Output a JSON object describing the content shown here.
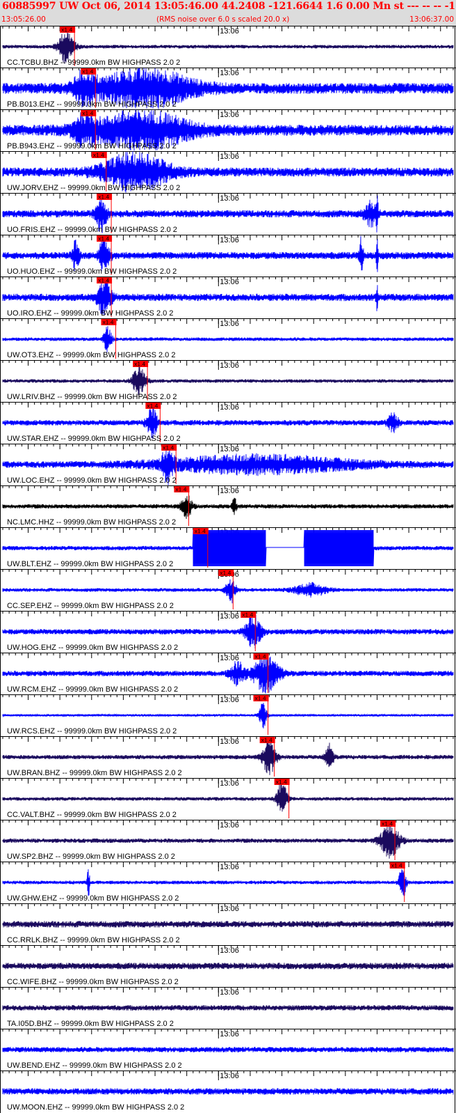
{
  "header": {
    "title": "60885997 UW Oct 06, 2014 13:05:46.00   44.2408 -121.6644  1.6 0.00 Mn st --- -- --  -1",
    "time_start": "13:05:26.00",
    "rms_note": "(RMS noise over 6.0 s scaled 20.0 x)",
    "time_end": "13:06:37.00"
  },
  "minute_label": "13:06",
  "pick_label": "x1.4",
  "colors": {
    "header_bg": "#dcdcdc",
    "header_text": "#ff0000",
    "trace_blue": "#0000ff",
    "trace_navy": "#1a0a5e",
    "trace_black": "#000000",
    "pick": "#ff0000"
  },
  "channels": [
    {
      "label": "CC.TCBU.BHZ -- 99999.0km BW  HIGHPASS  2.0  2",
      "color": "navy",
      "pick_sec": 9.0,
      "noise": 0.1,
      "events": [
        {
          "t": 10.0,
          "w": 1.2,
          "a": 0.9
        }
      ]
    },
    {
      "label": "PB.B013.EHZ -- 99999.0km BW  HIGHPASS  2.0  2",
      "color": "blue",
      "pick_sec": 12.3,
      "noise": 0.3,
      "events": [
        {
          "t": 13.0,
          "w": 1.5,
          "a": 1.0
        },
        {
          "t": 22.5,
          "w": 7.0,
          "a": 1.0
        }
      ]
    },
    {
      "label": "PB.B943.EHZ -- 99999.0km BW  HIGHPASS  2.0  2",
      "color": "blue",
      "pick_sec": 12.3,
      "noise": 0.3,
      "events": [
        {
          "t": 13.0,
          "w": 1.5,
          "a": 1.0
        },
        {
          "t": 22.0,
          "w": 7.0,
          "a": 1.0
        }
      ]
    },
    {
      "label": "UW.JORV.EHZ -- 99999.0km BW  HIGHPASS  2.0  2",
      "color": "blue",
      "pick_sec": 14.0,
      "noise": 0.25,
      "events": [
        {
          "t": 21.0,
          "w": 5.0,
          "a": 1.0
        }
      ]
    },
    {
      "label": "UO.FRIS.EHZ -- 99999.0km BW  HIGHPASS  2.0  2",
      "color": "blue",
      "pick_sec": 14.8,
      "noise": 0.2,
      "events": [
        {
          "t": 15.5,
          "w": 0.8,
          "a": 1.0
        },
        {
          "t": 58.0,
          "w": 1.0,
          "a": 0.6
        },
        {
          "t": 59.0,
          "w": 0.15,
          "a": 1.0
        }
      ]
    },
    {
      "label": "UO.HUO.EHZ -- 99999.0km BW  HIGHPASS  2.0  2",
      "color": "blue",
      "pick_sec": 14.8,
      "noise": 0.2,
      "events": [
        {
          "t": 11.5,
          "w": 0.5,
          "a": 0.8
        },
        {
          "t": 16.0,
          "w": 0.8,
          "a": 1.0
        },
        {
          "t": 56.5,
          "w": 0.3,
          "a": 1.0
        },
        {
          "t": 59.0,
          "w": 0.15,
          "a": 1.0
        }
      ]
    },
    {
      "label": "UO.IRO.EHZ -- 99999.0km BW  HIGHPASS  2.0  2",
      "color": "blue",
      "pick_sec": 14.8,
      "noise": 0.2,
      "events": [
        {
          "t": 16.0,
          "w": 1.0,
          "a": 1.0
        },
        {
          "t": 59.0,
          "w": 0.15,
          "a": 1.0
        }
      ]
    },
    {
      "label": "UW.OT3.EHZ -- 99999.0km BW  HIGHPASS  2.0  2",
      "color": "blue",
      "pick_sec": 15.5,
      "noise": 0.1,
      "events": [
        {
          "t": 16.5,
          "w": 0.6,
          "a": 0.7
        }
      ]
    },
    {
      "label": "UW.LRIV.BHZ -- 99999.0km BW  HIGHPASS  2.0  2",
      "color": "navy",
      "pick_sec": 20.5,
      "noise": 0.1,
      "events": [
        {
          "t": 21.5,
          "w": 1.0,
          "a": 0.8
        }
      ]
    },
    {
      "label": "UW.STAR.EHZ -- 99999.0km BW  HIGHPASS  2.0  2",
      "color": "blue",
      "pick_sec": 22.5,
      "noise": 0.15,
      "events": [
        {
          "t": 23.5,
          "w": 0.8,
          "a": 0.9
        },
        {
          "t": 61.5,
          "w": 0.8,
          "a": 0.5
        }
      ]
    },
    {
      "label": "UW.LOC.EHZ -- 99999.0km BW  HIGHPASS  2.0  2",
      "color": "blue",
      "pick_sec": 25.0,
      "noise": 0.18,
      "events": [
        {
          "t": 26.0,
          "w": 0.8,
          "a": 0.9
        },
        {
          "t": 40.0,
          "w": 15.0,
          "a": 0.45
        }
      ]
    },
    {
      "label": "NC.LMC.HHZ -- 99999.0km BW  HIGHPASS  2.0  2",
      "color": "black",
      "pick_sec": 27.0,
      "noise": 0.12,
      "events": [
        {
          "t": 29.0,
          "w": 0.8,
          "a": 0.6
        },
        {
          "t": 36.5,
          "w": 0.3,
          "a": 0.5
        }
      ]
    },
    {
      "label": "UW.BLT.EHZ -- 99999.0km BW  HIGHPASS  2.0  2",
      "color": "blue",
      "pick_sec": 30.0,
      "noise": 0.12,
      "events": [],
      "clipped": [
        [
          30.0,
          41.5
        ],
        [
          47.5,
          58.5
        ]
      ],
      "flat": [
        41.5,
        47.5
      ]
    },
    {
      "label": "CC.SEP.EHZ -- 99999.0km BW  HIGHPASS  2.0  2",
      "color": "blue",
      "pick_sec": 34.0,
      "noise": 0.1,
      "events": [
        {
          "t": 36.0,
          "w": 0.8,
          "a": 0.7
        },
        {
          "t": 48.5,
          "w": 2.5,
          "a": 0.35
        }
      ]
    },
    {
      "label": "UW.HOG.EHZ -- 99999.0km BW  HIGHPASS  2.0  2",
      "color": "blue",
      "pick_sec": 37.5,
      "noise": 0.15,
      "events": [
        {
          "t": 39.5,
          "w": 1.2,
          "a": 0.9
        }
      ]
    },
    {
      "label": "UW.RCM.EHZ -- 99999.0km BW  HIGHPASS  2.0  2",
      "color": "blue",
      "pick_sec": 39.5,
      "noise": 0.15,
      "events": [
        {
          "t": 37.0,
          "w": 1.2,
          "a": 0.6
        },
        {
          "t": 41.5,
          "w": 2.0,
          "a": 1.0
        }
      ]
    },
    {
      "label": "UW.RCS.EHZ -- 99999.0km BW  HIGHPASS  2.0  2",
      "color": "blue",
      "pick_sec": 39.5,
      "noise": 0.06,
      "events": [
        {
          "t": 41.0,
          "w": 0.6,
          "a": 0.7
        }
      ]
    },
    {
      "label": "UW.BRAN.BHZ -- 99999.0km BW  HIGHPASS  2.0  2",
      "color": "navy",
      "pick_sec": 40.5,
      "noise": 0.12,
      "events": [
        {
          "t": 42.0,
          "w": 1.0,
          "a": 1.0
        },
        {
          "t": 51.5,
          "w": 0.6,
          "a": 0.7
        }
      ]
    },
    {
      "label": "CC.VALT.BHZ -- 99999.0km BW  HIGHPASS  2.0  2",
      "color": "navy",
      "pick_sec": 42.8,
      "noise": 0.1,
      "events": [
        {
          "t": 44.0,
          "w": 0.8,
          "a": 0.9
        }
      ]
    },
    {
      "label": "UW.SP2.BHZ -- 99999.0km BW  HIGHPASS  2.0  2",
      "color": "navy",
      "pick_sec": 59.5,
      "noise": 0.12,
      "events": [
        {
          "t": 61.0,
          "w": 1.5,
          "a": 0.9
        }
      ]
    },
    {
      "label": "UW.GHW.EHZ -- 99999.0km BW  HIGHPASS  2.0  2",
      "color": "blue",
      "pick_sec": 61.0,
      "noise": 0.1,
      "events": [
        {
          "t": 13.5,
          "w": 0.2,
          "a": 0.8
        },
        {
          "t": 63.0,
          "w": 0.5,
          "a": 1.0
        }
      ]
    },
    {
      "label": "CC.RRLK.BHZ -- 99999.0km BW  HIGHPASS  2.0  2",
      "color": "navy",
      "pick_sec": null,
      "noise": 0.18,
      "events": []
    },
    {
      "label": "CC.WIFE.BHZ -- 99999.0km BW  HIGHPASS  2.0  2",
      "color": "navy",
      "pick_sec": null,
      "noise": 0.18,
      "events": []
    },
    {
      "label": "TA.I05D.BHZ -- 99999.0km BW  HIGHPASS  2.0  2",
      "color": "navy",
      "pick_sec": null,
      "noise": 0.15,
      "events": []
    },
    {
      "label": "UW.BEND.EHZ -- 99999.0km BW  HIGHPASS  2.0  2",
      "color": "blue",
      "pick_sec": null,
      "noise": 0.15,
      "events": []
    },
    {
      "label": "UW.MOON.EHZ -- 99999.0km BW  HIGHPASS  2.0  2",
      "color": "blue",
      "pick_sec": null,
      "noise": 0.18,
      "events": []
    }
  ]
}
